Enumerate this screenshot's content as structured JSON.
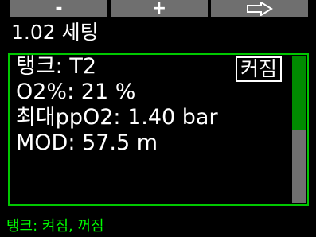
{
  "topbar": {
    "minus_label": "-",
    "plus_label": "+",
    "next_icon": "arrow-right-icon"
  },
  "title": "1.02 세팅",
  "panel": {
    "tank_label": "탱크: T2",
    "tank_value": "커짐",
    "o2_label": "O2%: 21 %",
    "ppo2_label": "최대ppO2: 1.40 bar",
    "mod_label": "MOD:   57.5 m",
    "scroll_position": 0.5
  },
  "hint": "탱크: 켜짐, 꺼짐",
  "colors": {
    "accent_green": "#00c800",
    "hint_green": "#00ff00",
    "button_gray": "#6f6f6f"
  }
}
